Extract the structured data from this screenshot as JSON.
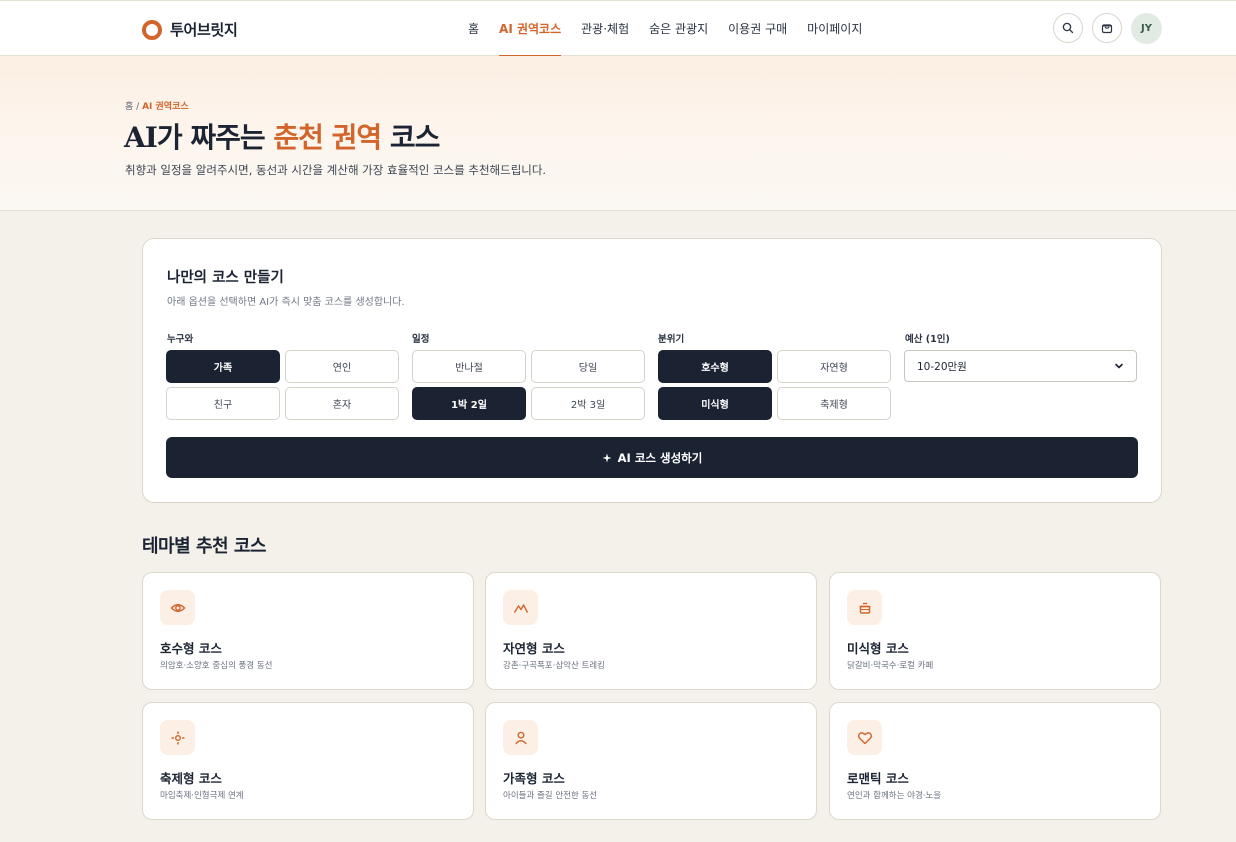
{
  "brand": {
    "name": "투어브릿지",
    "accent": "#d2652b",
    "dark": "#1b2333"
  },
  "nav": {
    "items": [
      {
        "label": "홈",
        "active": false
      },
      {
        "label": "AI 권역코스",
        "active": true
      },
      {
        "label": "관광·체험",
        "active": false
      },
      {
        "label": "숨은 관광지",
        "active": false
      },
      {
        "label": "이용권 구매",
        "active": false
      },
      {
        "label": "마이페이지",
        "active": false
      }
    ],
    "search_icon": "search-icon",
    "cart_icon": "shopping-bag-icon",
    "avatar_initials": "JY"
  },
  "hero": {
    "breadcrumb_home": "홈",
    "breadcrumb_sep": "/",
    "breadcrumb_current": "AI 권역코스",
    "title_before": "AI가 짜주는 ",
    "title_highlight": "춘천 권역",
    "title_after": " 코스",
    "subtitle": "취향과 일정을 알려주시면, 동선과 시간을 계산해 가장 효율적인 코스를 추천해드립니다."
  },
  "builder": {
    "title": "나만의 코스 만들기",
    "subtitle": "아래 옵션을 선택하면 AI가 즉시 맞춤 코스를 생성합니다.",
    "groups": {
      "who": {
        "label": "누구와",
        "options": [
          {
            "label": "가족",
            "selected": true
          },
          {
            "label": "연인",
            "selected": false
          },
          {
            "label": "친구",
            "selected": false
          },
          {
            "label": "혼자",
            "selected": false
          }
        ]
      },
      "schedule": {
        "label": "일정",
        "options": [
          {
            "label": "반나절",
            "selected": false
          },
          {
            "label": "당일",
            "selected": false
          },
          {
            "label": "1박 2일",
            "selected": true
          },
          {
            "label": "2박 3일",
            "selected": false
          }
        ]
      },
      "mood": {
        "label": "분위기",
        "options": [
          {
            "label": "호수형",
            "selected": true
          },
          {
            "label": "자연형",
            "selected": false
          },
          {
            "label": "미식형",
            "selected": true
          },
          {
            "label": "축제형",
            "selected": false
          }
        ]
      },
      "budget": {
        "label": "예산 (1인)",
        "value": "10-20만원"
      }
    },
    "generate_label": "AI 코스 생성하기",
    "generate_icon": "sparkle-icon"
  },
  "themes": {
    "title": "테마별 추천 코스",
    "items": [
      {
        "icon": "eye-icon",
        "name": "호수형 코스",
        "desc": "의암호·소양호 중심의 풍경 동선"
      },
      {
        "icon": "mountain-icon",
        "name": "자연형 코스",
        "desc": "강촌·구곡폭포·삼악산 트레킹"
      },
      {
        "icon": "pot-icon",
        "name": "미식형 코스",
        "desc": "닭갈비·막국수·로컬 카페"
      },
      {
        "icon": "sparkle-burst-icon",
        "name": "축제형 코스",
        "desc": "마임축제·인형극제 연계"
      },
      {
        "icon": "person-icon",
        "name": "가족형 코스",
        "desc": "아이들과 즐길 안전한 동선"
      },
      {
        "icon": "heart-icon",
        "name": "로맨틱 코스",
        "desc": "연인과 함께하는 야경·노을"
      }
    ]
  }
}
